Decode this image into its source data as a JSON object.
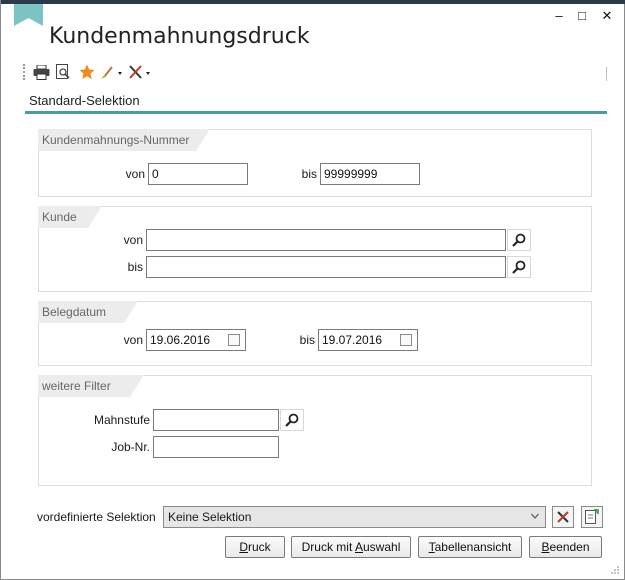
{
  "window": {
    "title": "Kundenmahnungsdruck",
    "minimize": "–",
    "maximize": "□",
    "close": "✕"
  },
  "toolbar": {
    "icons": [
      "printer-icon",
      "preview-icon",
      "star-icon",
      "brush-icon",
      "tools-icon"
    ]
  },
  "tabs": [
    {
      "label": "Standard-Selektion",
      "active": true
    }
  ],
  "groups": {
    "mahnnummer": {
      "title": "Kundenmahnungs-Nummer",
      "von_label": "von",
      "von_value": "0",
      "bis_label": "bis",
      "bis_value": "99999999"
    },
    "kunde": {
      "title": "Kunde",
      "von_label": "von",
      "von_value": "",
      "bis_label": "bis",
      "bis_value": ""
    },
    "belegdatum": {
      "title": "Belegdatum",
      "von_label": "von",
      "von_value": "19.06.2016",
      "bis_label": "bis",
      "bis_value": "19.07.2016"
    },
    "filter": {
      "title": "weitere Filter",
      "mahnstufe_label": "Mahnstufe",
      "mahnstufe_value": "",
      "jobnr_label": "Job-Nr.",
      "jobnr_value": ""
    }
  },
  "preselection": {
    "label": "vordefinierte Selektion",
    "value": "Keine Selektion"
  },
  "buttons": {
    "druck": {
      "accel": "D",
      "rest": "ruck"
    },
    "druck_auswahl": {
      "pre": "Druck mit ",
      "accel": "A",
      "rest": "uswahl"
    },
    "tabellenansicht": {
      "accel": "T",
      "rest": "abellenansicht"
    },
    "beenden": {
      "accel": "B",
      "rest": "eenden"
    }
  },
  "colors": {
    "accent": "#4a9aa2",
    "bookmark": "#7cc3c3",
    "star": "#f08a1c"
  }
}
